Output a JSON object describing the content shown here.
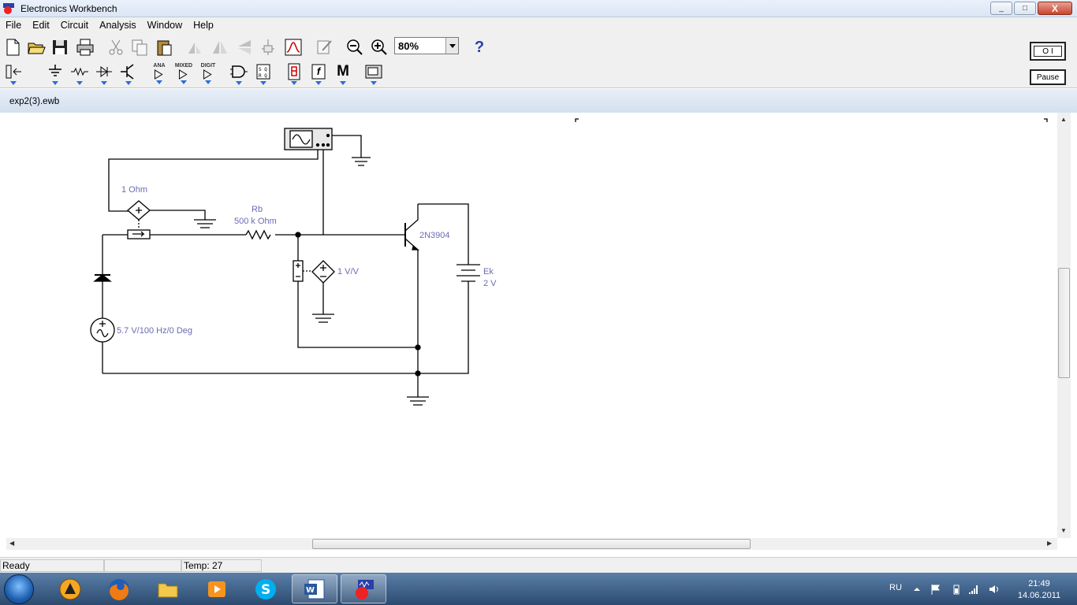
{
  "window": {
    "title": "Electronics Workbench",
    "min": "_",
    "max": "□",
    "close": "X"
  },
  "menu": [
    "File",
    "Edit",
    "Circuit",
    "Analysis",
    "Window",
    "Help"
  ],
  "toolbar": {
    "zoom_value": "80%",
    "help_label": "?"
  },
  "parts_bin": {
    "analog_label": "ANA",
    "mixed_label": "MIXED",
    "digital_label": "DIGIT",
    "misc_label": "M",
    "f_label": "f"
  },
  "controls": {
    "power_off": "O",
    "power_on": "I",
    "pause_label": "Pause"
  },
  "document": {
    "title": "exp2(3).ewb"
  },
  "circuit": {
    "ammeter_label": "1  Ohm",
    "resistor_name": "Rb",
    "resistor_value": "500 k Ohm",
    "transistor_model": "2N3904",
    "vcvs_gain": "1 V/V",
    "battery_name": "Ek",
    "battery_value": "2 V",
    "source_label": "5.7 V/100 Hz/0 Deg"
  },
  "status": {
    "ready": "Ready",
    "temp_label": "Temp:  27"
  },
  "tray": {
    "language": "RU",
    "time": "21:49",
    "date": "14.06.2011"
  }
}
